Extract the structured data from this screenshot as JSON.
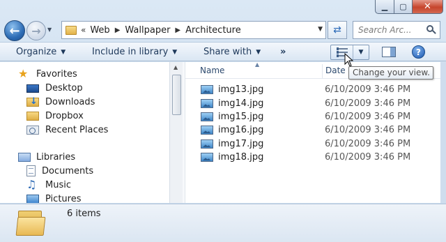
{
  "window": {
    "caption": {
      "minimize": "▁",
      "maximize": "▢",
      "close": "✕"
    }
  },
  "nav": {
    "back_glyph": "←",
    "forward_glyph": "→",
    "breadcrumb": [
      "Web",
      "Wallpaper",
      "Architecture"
    ],
    "overflow_chevron": "«",
    "search_placeholder": "Search Arc...",
    "icons": {
      "back": "back-arrow-icon",
      "forward": "forward-arrow-icon",
      "refresh": "refresh-icon",
      "search": "search-icon"
    }
  },
  "toolbar": {
    "organize": "Organize",
    "include_in_library": "Include in library",
    "share_with": "Share with",
    "more": "»",
    "help": "?",
    "view_icon": "details-view-icon"
  },
  "tooltip": {
    "text": "Change your view."
  },
  "sidebar": {
    "favorites": {
      "label": "Favorites",
      "items": [
        {
          "label": "Desktop",
          "icon": "desktop-icon"
        },
        {
          "label": "Downloads",
          "icon": "downloads-folder-icon"
        },
        {
          "label": "Dropbox",
          "icon": "dropbox-folder-icon"
        },
        {
          "label": "Recent Places",
          "icon": "recent-places-icon"
        }
      ]
    },
    "libraries": {
      "label": "Libraries",
      "items": [
        {
          "label": "Documents",
          "icon": "documents-icon"
        },
        {
          "label": "Music",
          "icon": "music-icon"
        },
        {
          "label": "Pictures",
          "icon": "pictures-icon"
        }
      ]
    }
  },
  "file_list": {
    "columns": {
      "name": "Name",
      "date": "Date"
    },
    "files": [
      {
        "name": "img13.jpg",
        "date": "6/10/2009 3:46 PM"
      },
      {
        "name": "img14.jpg",
        "date": "6/10/2009 3:46 PM"
      },
      {
        "name": "img15.jpg",
        "date": "6/10/2009 3:46 PM"
      },
      {
        "name": "img16.jpg",
        "date": "6/10/2009 3:46 PM"
      },
      {
        "name": "img17.jpg",
        "date": "6/10/2009 3:46 PM"
      },
      {
        "name": "img18.jpg",
        "date": "6/10/2009 3:46 PM"
      }
    ]
  },
  "status": {
    "item_count": "6 items"
  },
  "colors": {
    "accent": "#1e395b",
    "frame": "#c3d6ea",
    "close": "#c6442c"
  }
}
